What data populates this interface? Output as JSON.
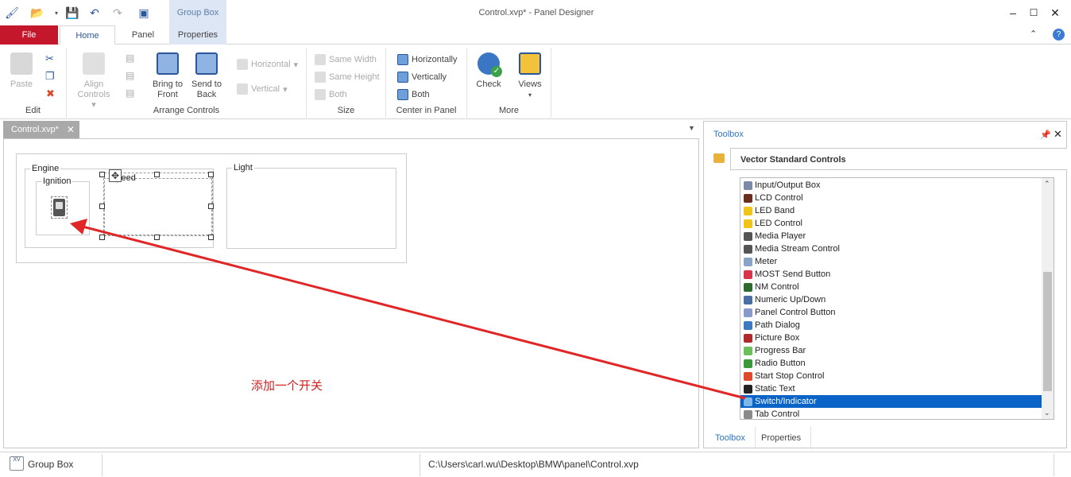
{
  "window": {
    "title": "Control.xvp* - Panel Designer",
    "context_tab_group": "Group Box"
  },
  "ribbon_tabs": {
    "file": "File",
    "home": "Home",
    "panel": "Panel",
    "properties": "Properties"
  },
  "ribbon": {
    "edit": {
      "label": "Edit",
      "paste": "Paste"
    },
    "arrange": {
      "label": "Arrange Controls",
      "align_controls_1": "Align",
      "align_controls_2": "Controls",
      "bring_front_1": "Bring to",
      "bring_front_2": "Front",
      "send_back_1": "Send to",
      "send_back_2": "Back",
      "horizontal": "Horizontal",
      "vertical": "Vertical"
    },
    "size": {
      "label": "Size",
      "same_width": "Same Width",
      "same_height": "Same Height",
      "both": "Both"
    },
    "center": {
      "label": "Center in Panel",
      "horizontally": "Horizontally",
      "vertically": "Vertically",
      "both": "Both"
    },
    "more": {
      "label": "More",
      "check": "Check",
      "views": "Views"
    }
  },
  "document": {
    "tab": "Control.xvp*"
  },
  "panel": {
    "engine": "Engine",
    "ignition": "Ignition",
    "speed": "Speed",
    "light": "Light"
  },
  "annotation": "添加一个开关",
  "toolbox": {
    "title": "Toolbox",
    "category": "Vector Standard Controls",
    "items": [
      {
        "label": "Input/Output Box",
        "color": "#7a8aa8"
      },
      {
        "label": "LCD Control",
        "color": "#6b2d1d"
      },
      {
        "label": "LED Band",
        "color": "#f0c419"
      },
      {
        "label": "LED Control",
        "color": "#f0c419"
      },
      {
        "label": "Media Player",
        "color": "#555555"
      },
      {
        "label": "Media Stream Control",
        "color": "#555555"
      },
      {
        "label": "Meter",
        "color": "#8aa3c8"
      },
      {
        "label": "MOST Send Button",
        "color": "#d8354a"
      },
      {
        "label": "NM Control",
        "color": "#2d6b2d"
      },
      {
        "label": "Numeric Up/Down",
        "color": "#4a6fa5"
      },
      {
        "label": "Panel Control Button",
        "color": "#8899cc"
      },
      {
        "label": "Path Dialog",
        "color": "#3c7ac2"
      },
      {
        "label": "Picture Box",
        "color": "#b02a2a"
      },
      {
        "label": "Progress Bar",
        "color": "#6cbf5a"
      },
      {
        "label": "Radio Button",
        "color": "#3a9a3a"
      },
      {
        "label": "Start Stop Control",
        "color": "#e04a2a"
      },
      {
        "label": "Static Text",
        "color": "#222222"
      },
      {
        "label": "Switch/Indicator",
        "color": "#7fb7e8"
      },
      {
        "label": "Tab Control",
        "color": "#8a8a8a"
      }
    ],
    "selected_index": 17,
    "bottom_tabs": {
      "toolbox": "Toolbox",
      "properties": "Properties"
    }
  },
  "status": {
    "selection": "Group Box",
    "path": "C:\\Users\\carl.wu\\Desktop\\BMW\\panel\\Control.xvp"
  },
  "colors": {
    "file_tab": "#c4172c",
    "accent": "#2b579a",
    "selection": "#0a64c8",
    "arrow": "#e02626"
  }
}
